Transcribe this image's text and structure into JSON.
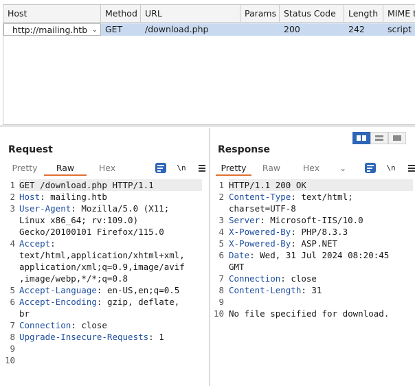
{
  "history_table": {
    "columns": [
      "Host",
      "Method",
      "URL",
      "Params",
      "Status Code",
      "Length",
      "MIME t"
    ],
    "rows": [
      {
        "host": "http://mailing.htb",
        "method": "GET",
        "url": "/download.php",
        "params": "",
        "status": "200",
        "length": "242",
        "mime": "script"
      }
    ]
  },
  "request": {
    "title": "Request",
    "tabs": [
      "Pretty",
      "Raw",
      "Hex"
    ],
    "active_tab": "Raw",
    "tool_newline": "\\n",
    "gutter": [
      "1",
      "2",
      "3",
      "",
      "",
      "4",
      "",
      "",
      "",
      "5",
      "6",
      "",
      "7",
      "8",
      "9",
      "10"
    ],
    "lines": [
      {
        "k": "",
        "v": "GET /download.php HTTP/1.1"
      },
      {
        "k": "Host",
        "v": ": mailing.htb"
      },
      {
        "k": "User-Agent",
        "v": ": Mozilla/5.0 (X11;"
      },
      {
        "k": "",
        "v": "Linux x86_64; rv:109.0)"
      },
      {
        "k": "",
        "v": "Gecko/20100101 Firefox/115.0"
      },
      {
        "k": "Accept",
        "v": ":"
      },
      {
        "k": "",
        "v": "text/html,application/xhtml+xml,"
      },
      {
        "k": "",
        "v": "application/xml;q=0.9,image/avif"
      },
      {
        "k": "",
        "v": ",image/webp,*/*;q=0.8"
      },
      {
        "k": "Accept-Language",
        "v": ": en-US,en;q=0.5"
      },
      {
        "k": "Accept-Encoding",
        "v": ": gzip, deflate,"
      },
      {
        "k": "",
        "v": "br"
      },
      {
        "k": "Connection",
        "v": ": close"
      },
      {
        "k": "Upgrade-Insecure-Requests",
        "v": ": 1"
      },
      {
        "k": "",
        "v": ""
      },
      {
        "k": "",
        "v": ""
      }
    ]
  },
  "response": {
    "title": "Response",
    "tabs": [
      "Pretty",
      "Raw",
      "Hex"
    ],
    "active_tab": "Pretty",
    "tool_newline": "\\n",
    "gutter": [
      "1",
      "2",
      "",
      "3",
      "4",
      "5",
      "6",
      "",
      "7",
      "8",
      "9",
      "10"
    ],
    "lines": [
      {
        "k": "",
        "v": "HTTP/1.1 200 OK"
      },
      {
        "k": "Content-Type",
        "v": ": text/html;"
      },
      {
        "k": "",
        "v": "charset=UTF-8"
      },
      {
        "k": "Server",
        "v": ": Microsoft-IIS/10.0"
      },
      {
        "k": "X-Powered-By",
        "v": ": PHP/8.3.3"
      },
      {
        "k": "X-Powered-By",
        "v": ": ASP.NET"
      },
      {
        "k": "Date",
        "v": ": Wed, 31 Jul 2024 08:20:45"
      },
      {
        "k": "",
        "v": "GMT"
      },
      {
        "k": "Connection",
        "v": ": close"
      },
      {
        "k": "Content-Length",
        "v": ": 31"
      },
      {
        "k": "",
        "v": ""
      },
      {
        "k": "",
        "v": "No file specified for download."
      }
    ]
  },
  "colors": {
    "accent": "#2e66b8",
    "tab_underline": "#e07030",
    "header_key": "#1f4fa0",
    "selection": "#c9daf0"
  },
  "icons": [
    "chevron-down-icon",
    "split-view-icon",
    "stacked-view-icon",
    "single-view-icon",
    "word-wrap-icon",
    "newline-toggle-icon",
    "hamburger-menu-icon"
  ]
}
